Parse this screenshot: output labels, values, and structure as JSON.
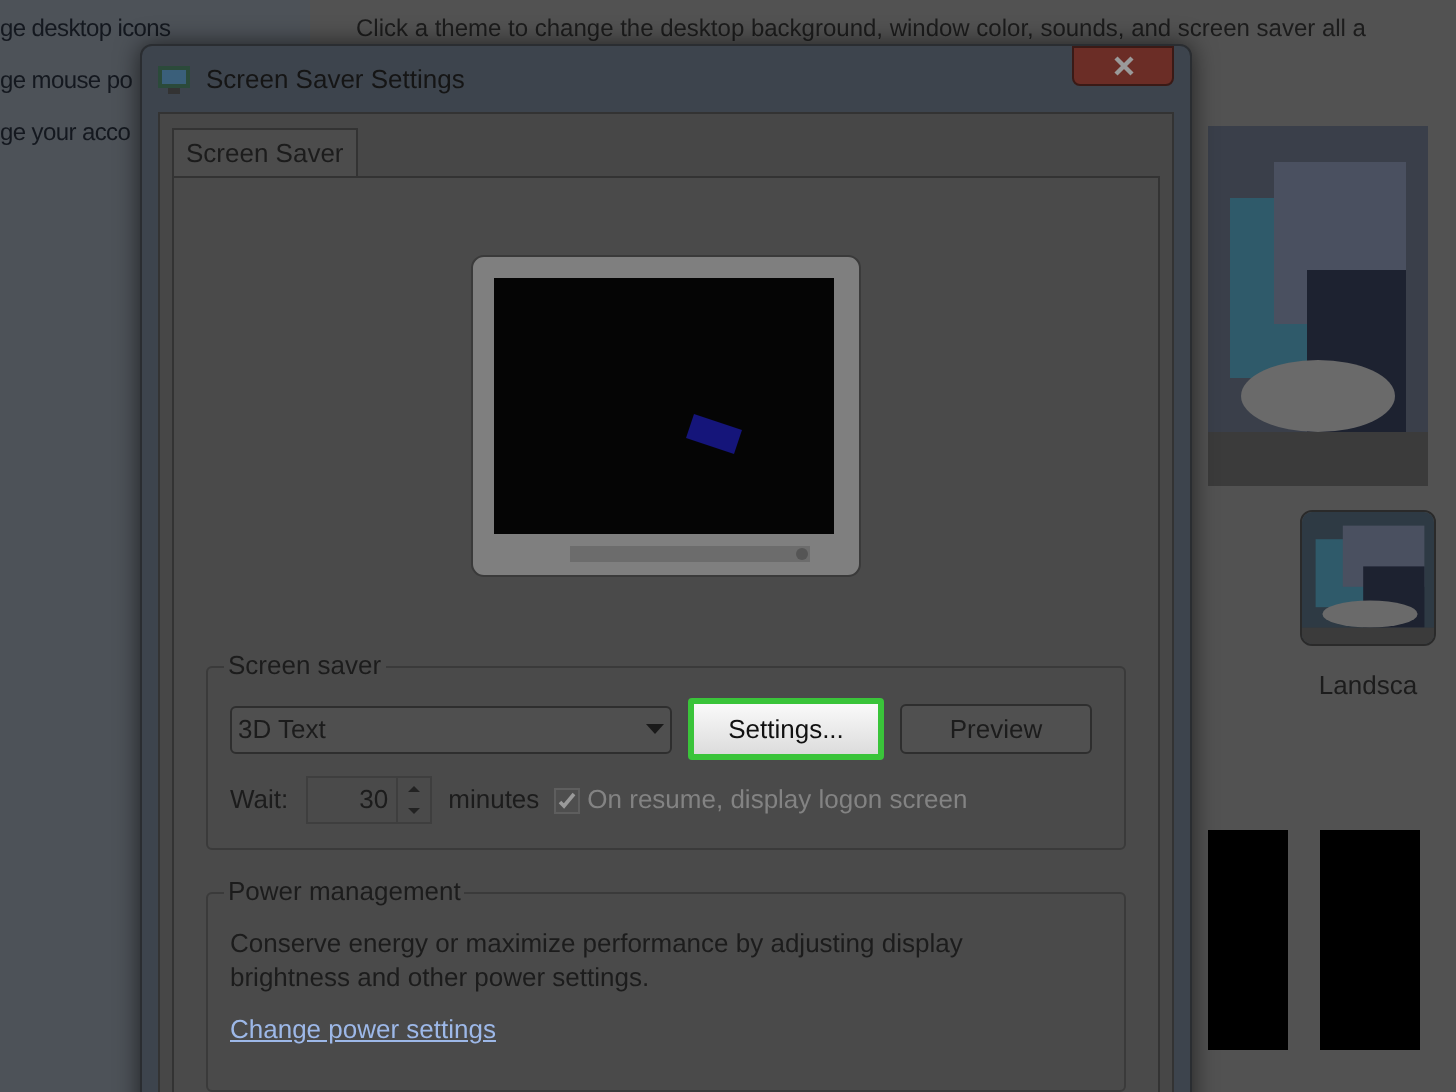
{
  "background_window": {
    "sidebar_links": [
      "ge desktop icons",
      "ge mouse po",
      "ge your acco"
    ],
    "description": "Click a theme to change the desktop background, window color, sounds, and screen saver all a",
    "themes": [
      {
        "label": "Landsca"
      }
    ]
  },
  "dialog": {
    "title": "Screen Saver Settings",
    "tabs": [
      {
        "label": "Screen Saver",
        "selected": true
      }
    ],
    "screen_saver": {
      "legend": "Screen saver",
      "selected_saver": "3D Text",
      "settings_button": "Settings...",
      "settings_highlighted": true,
      "preview_button": "Preview",
      "wait_label": "Wait:",
      "wait_value": "30",
      "minutes_label": "minutes",
      "logon_checkbox": {
        "label": "On resume, display logon screen",
        "checked": true,
        "disabled": true
      }
    },
    "power": {
      "legend": "Power management",
      "description": "Conserve energy or maximize performance by adjusting display brightness and other power settings.",
      "link": "Change power settings"
    }
  }
}
